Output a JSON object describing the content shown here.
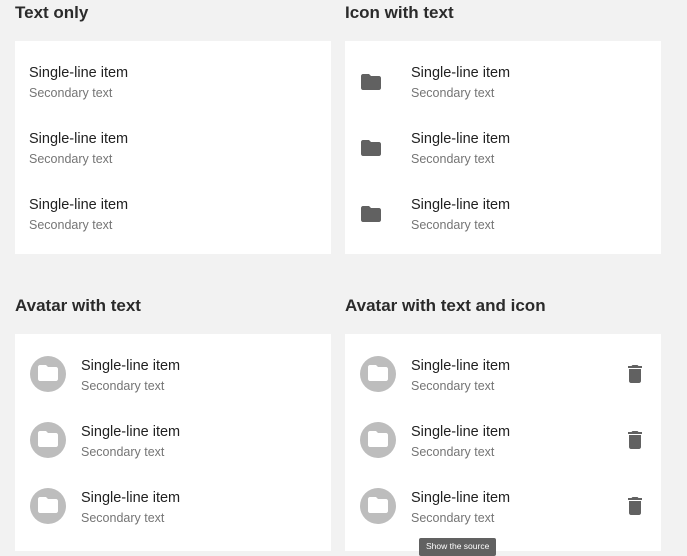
{
  "sections": {
    "text_only": {
      "title": "Text only",
      "items": [
        {
          "primary": "Single-line item",
          "secondary": "Secondary text"
        },
        {
          "primary": "Single-line item",
          "secondary": "Secondary text"
        },
        {
          "primary": "Single-line item",
          "secondary": "Secondary text"
        }
      ]
    },
    "icon_with_text": {
      "title": "Icon with text",
      "icon": "folder-icon",
      "items": [
        {
          "primary": "Single-line item",
          "secondary": "Secondary text"
        },
        {
          "primary": "Single-line item",
          "secondary": "Secondary text"
        },
        {
          "primary": "Single-line item",
          "secondary": "Secondary text"
        }
      ]
    },
    "avatar_with_text": {
      "title": "Avatar with text",
      "icon": "folder-icon",
      "items": [
        {
          "primary": "Single-line item",
          "secondary": "Secondary text"
        },
        {
          "primary": "Single-line item",
          "secondary": "Secondary text"
        },
        {
          "primary": "Single-line item",
          "secondary": "Secondary text"
        }
      ]
    },
    "avatar_with_text_and_icon": {
      "title": "Avatar with text and icon",
      "icon": "folder-icon",
      "action_icon": "trash-icon",
      "items": [
        {
          "primary": "Single-line item",
          "secondary": "Secondary text"
        },
        {
          "primary": "Single-line item",
          "secondary": "Secondary text"
        },
        {
          "primary": "Single-line item",
          "secondary": "Secondary text"
        }
      ]
    }
  },
  "tooltip": {
    "label": "Show the source"
  },
  "colors": {
    "background": "#f2f2f2",
    "card": "#ffffff",
    "icon": "#616161",
    "avatar": "#bdbdbd",
    "secondary_text": "#757575"
  }
}
